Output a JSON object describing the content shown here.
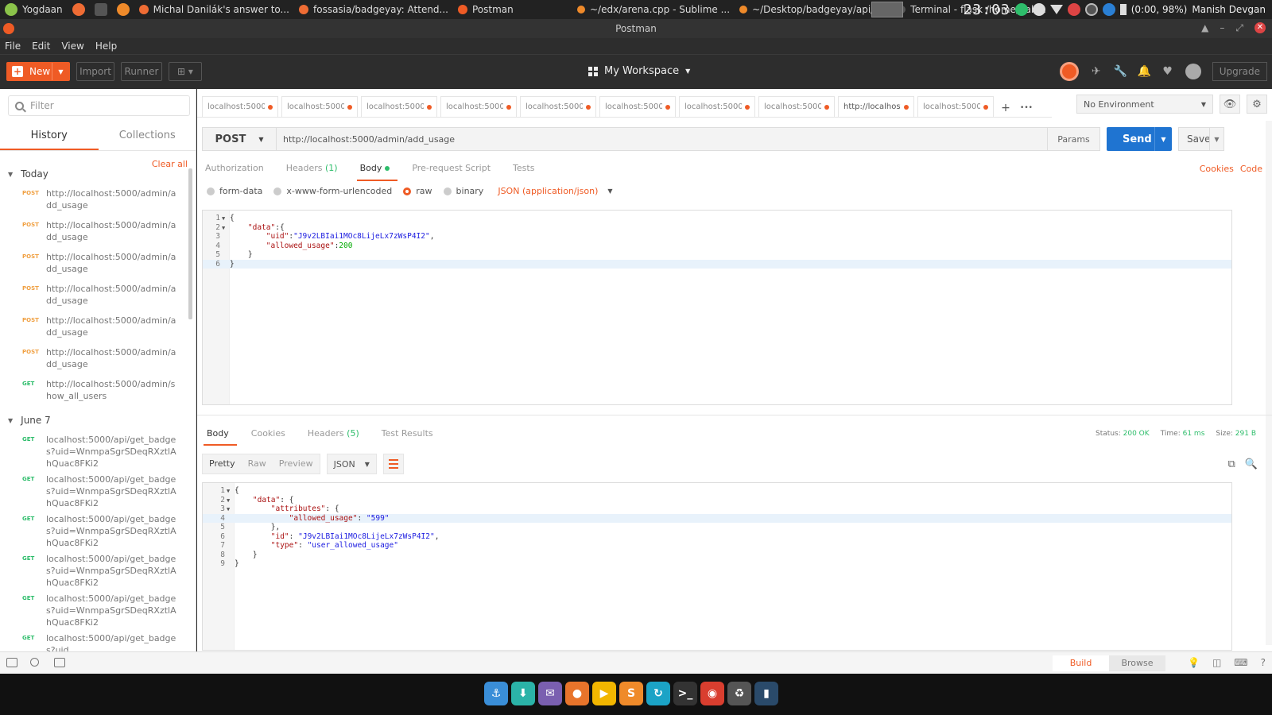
{
  "os_bar": {
    "items": [
      {
        "label": "Yogdaan",
        "color": "#8bc34a"
      },
      {
        "label": "",
        "color": "#ef6c34"
      },
      {
        "label": "",
        "color": "#555"
      },
      {
        "label": "",
        "color": "#ef8a2a"
      },
      {
        "label": "Michal Danilák's answer to...",
        "color": "#ef6c34"
      },
      {
        "label": "fossasia/badgeyay: Attend...",
        "color": "#ef6c34"
      },
      {
        "label": "Postman",
        "color": "#ef5b25"
      },
      {
        "label": "~/edx/arena.cpp - Sublime ...",
        "color": "#ef8a2a"
      },
      {
        "label": "~/Desktop/badgeyay/api/c...",
        "color": "#ef8a2a"
      },
      {
        "label": "Terminal - flask  /home/gab...",
        "color": "#555"
      }
    ],
    "clock": "23:03",
    "battery": "(0:00, 98%)",
    "user": "Manish Devgan"
  },
  "window": {
    "title": "Postman"
  },
  "menu": {
    "file": "File",
    "edit": "Edit",
    "view": "View",
    "help": "Help"
  },
  "header": {
    "new_label": "New",
    "import_label": "Import",
    "runner_label": "Runner",
    "workspace_label": "My Workspace",
    "upgrade_label": "Upgrade"
  },
  "sidebar": {
    "filter_placeholder": "Filter",
    "tab_history": "History",
    "tab_collections": "Collections",
    "clear_all": "Clear all",
    "groups": [
      {
        "title": "Today",
        "items": [
          {
            "method": "POST",
            "url": "http://localhost:5000/admin/add_usage"
          },
          {
            "method": "POST",
            "url": "http://localhost:5000/admin/add_usage"
          },
          {
            "method": "POST",
            "url": "http://localhost:5000/admin/add_usage"
          },
          {
            "method": "POST",
            "url": "http://localhost:5000/admin/add_usage"
          },
          {
            "method": "POST",
            "url": "http://localhost:5000/admin/add_usage"
          },
          {
            "method": "POST",
            "url": "http://localhost:5000/admin/add_usage"
          },
          {
            "method": "GET",
            "url": "http://localhost:5000/admin/show_all_users"
          }
        ]
      },
      {
        "title": "June 7",
        "items": [
          {
            "method": "GET",
            "url": "localhost:5000/api/get_badges?uid=WnmpaSgrSDeqRXztlAhQuac8FKi2"
          },
          {
            "method": "GET",
            "url": "localhost:5000/api/get_badges?uid=WnmpaSgrSDeqRXztlAhQuac8FKi2"
          },
          {
            "method": "GET",
            "url": "localhost:5000/api/get_badges?uid=WnmpaSgrSDeqRXztlAhQuac8FKi2"
          },
          {
            "method": "GET",
            "url": "localhost:5000/api/get_badges?uid=WnmpaSgrSDeqRXztlAhQuac8FKi2"
          },
          {
            "method": "GET",
            "url": "localhost:5000/api/get_badges?uid=WnmpaSgrSDeqRXztlAhQuac8FKi2"
          },
          {
            "method": "GET",
            "url": "localhost:5000/api/get_badges?uid"
          }
        ]
      }
    ]
  },
  "tabs": [
    {
      "label": "localhost:5000/"
    },
    {
      "label": "localhost:5000/j"
    },
    {
      "label": "localhost:5000/a"
    },
    {
      "label": "localhost:5000/"
    },
    {
      "label": "localhost:5000/a"
    },
    {
      "label": "localhost:5000/"
    },
    {
      "label": "localhost:5000/a"
    },
    {
      "label": "localhost:5000/"
    },
    {
      "label": "http://localhost:"
    },
    {
      "label": "localhost:5000/a"
    }
  ],
  "environment": {
    "selected": "No Environment"
  },
  "request": {
    "method": "POST",
    "url": "http://localhost:5000/admin/add_usage",
    "params_label": "Params",
    "send_label": "Send",
    "save_label": "Save",
    "subtabs": {
      "authorization": "Authorization",
      "headers": "Headers",
      "headers_count": "(1)",
      "body": "Body",
      "prerequest": "Pre-request Script",
      "tests": "Tests"
    },
    "cookies_link": "Cookies",
    "code_link": "Code",
    "body_types": {
      "form_data": "form-data",
      "urlencoded": "x-www-form-urlencoded",
      "raw": "raw",
      "binary": "binary",
      "content_type": "JSON (application/json)"
    },
    "code_lines": [
      "{",
      "    \"data\":{",
      "        \"uid\":\"J9v2LBIai1MOc8LijeLx7zWsP4I2\",",
      "        \"allowed_usage\":200",
      "    }",
      "}"
    ]
  },
  "response": {
    "tabs": {
      "body": "Body",
      "cookies": "Cookies",
      "headers": "Headers",
      "headers_count": "(5)",
      "test_results": "Test Results"
    },
    "status_label": "Status:",
    "status_value": "200 OK",
    "time_label": "Time:",
    "time_value": "61 ms",
    "size_label": "Size:",
    "size_value": "291 B",
    "view_modes": {
      "pretty": "Pretty",
      "raw": "Raw",
      "preview": "Preview"
    },
    "format": "JSON",
    "code_lines": [
      "{",
      "    \"data\": {",
      "        \"attributes\": {",
      "            \"allowed_usage\": \"599\"",
      "        },",
      "        \"id\": \"J9v2LBIai1MOc8LijeLx7zWsP4I2\",",
      "        \"type\": \"user_allowed_usage\"",
      "    }",
      "}"
    ]
  },
  "statusbar": {
    "build": "Build",
    "browse": "Browse"
  },
  "dock": {
    "icons": [
      {
        "name": "anchor-icon",
        "glyph": "⚓",
        "color": "#3a8ed8"
      },
      {
        "name": "download-icon",
        "glyph": "⬇",
        "color": "#2bb3a8"
      },
      {
        "name": "mail-icon",
        "glyph": "✉",
        "color": "#7a5fb0"
      },
      {
        "name": "firefox-icon",
        "glyph": "●",
        "color": "#e8742b"
      },
      {
        "name": "media-player-icon",
        "glyph": "▶",
        "color": "#f2b600"
      },
      {
        "name": "sublime-icon",
        "glyph": "S",
        "color": "#ef8a2a"
      },
      {
        "name": "refresh-icon",
        "glyph": "↻",
        "color": "#1ba3c6"
      },
      {
        "name": "terminal-icon",
        "glyph": ">_",
        "color": "#333"
      },
      {
        "name": "chrome-icon",
        "glyph": "◉",
        "color": "#d93e2f"
      },
      {
        "name": "trash-icon",
        "glyph": "♻",
        "color": "#555"
      },
      {
        "name": "window-switcher-icon",
        "glyph": "▮",
        "color": "#2a4a6a"
      }
    ]
  }
}
